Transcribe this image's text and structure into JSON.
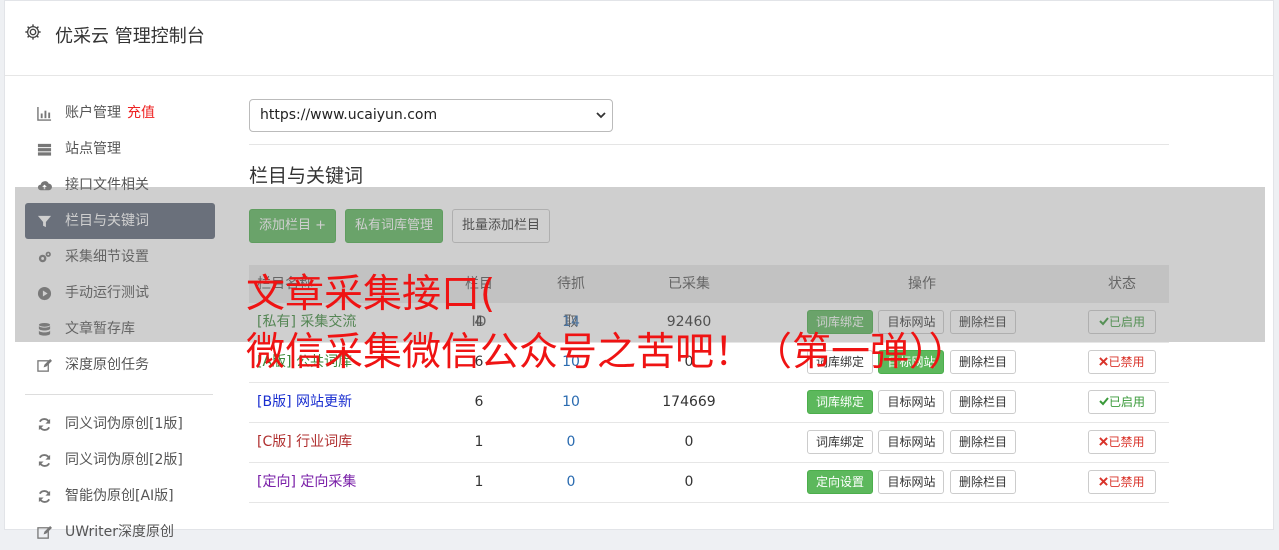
{
  "header": {
    "title": "优采云 管理控制台",
    "icon": "gear-icon"
  },
  "sidebar": {
    "items": [
      {
        "label": "账户管理",
        "extra": "充值",
        "icon": "bar-chart-icon"
      },
      {
        "label": "站点管理",
        "icon": "server-icon"
      },
      {
        "label": "接口文件相关",
        "icon": "cloud-upload-icon"
      },
      {
        "label": "栏目与关键词",
        "icon": "filter-icon",
        "active": true
      },
      {
        "label": "采集细节设置",
        "icon": "cogs-icon"
      },
      {
        "label": "手动运行测试",
        "icon": "play-circle-icon"
      },
      {
        "label": "文章暂存库",
        "icon": "database-icon"
      },
      {
        "label": "深度原创任务",
        "icon": "edit-icon"
      }
    ],
    "items2": [
      {
        "label": "同义词伪原创[1版]",
        "icon": "refresh-icon"
      },
      {
        "label": "同义词伪原创[2版]",
        "icon": "refresh-icon"
      },
      {
        "label": "智能伪原创[AI版]",
        "icon": "refresh-icon"
      },
      {
        "label": "UWriter深度原创",
        "icon": "edit-icon"
      }
    ]
  },
  "main": {
    "site_select": "https://www.ucaiyun.com",
    "section_title": "栏目与关键词",
    "buttons": {
      "add": "添加栏目 +",
      "private": "私有词库管理",
      "batch": "批量添加栏目"
    },
    "table": {
      "headers": {
        "name": "栏目名称",
        "id": "栏目ID",
        "pending": "待抓取",
        "collected": "已采集",
        "ops": "操作",
        "status": "状态"
      },
      "rows": [
        {
          "tag": "[私有]",
          "name": "采集交流",
          "id": "4",
          "pending": "14",
          "collected": "92460",
          "bind": "词库绑定",
          "target": "目标网站",
          "del": "删除栏目",
          "status": "已启用",
          "enabled": true,
          "color": "#3a8a3a",
          "bind_green": true
        },
        {
          "tag": "[A版]",
          "name": "公共词库",
          "id": "6",
          "pending": "10",
          "collected": "0",
          "bind": "词库绑定",
          "target": "目标网站",
          "del": "删除栏目",
          "status": "已禁用",
          "enabled": false,
          "color": "#3a8a3a",
          "bind_green": false,
          "target_green": true
        },
        {
          "tag": "[B版]",
          "name": "网站更新",
          "id": "6",
          "pending": "10",
          "collected": "174669",
          "bind": "词库绑定",
          "target": "目标网站",
          "del": "删除栏目",
          "status": "已启用",
          "enabled": true,
          "color": "#1a2fd0",
          "bind_green": true
        },
        {
          "tag": "[C版]",
          "name": "行业词库",
          "id": "1",
          "pending": "0",
          "collected": "0",
          "bind": "词库绑定",
          "target": "目标网站",
          "del": "删除栏目",
          "status": "已禁用",
          "enabled": false,
          "color": "#b03030",
          "bind_green": false
        },
        {
          "tag": "[定向]",
          "name": "定向采集",
          "id": "1",
          "pending": "0",
          "collected": "0",
          "bind": "定向设置",
          "target": "目标网站",
          "del": "删除栏目",
          "status": "已禁用",
          "enabled": false,
          "color": "#7a20a8",
          "bind_green": true
        }
      ]
    }
  },
  "overlay": {
    "line1": "文章采集接口(",
    "line2": "微信采集微信公众号之苦吧！（第一弹））"
  },
  "colors": {
    "accent_green": "#5cb85c",
    "sidebar_active": "#5c6678",
    "overlay_text": "#ef1313"
  }
}
